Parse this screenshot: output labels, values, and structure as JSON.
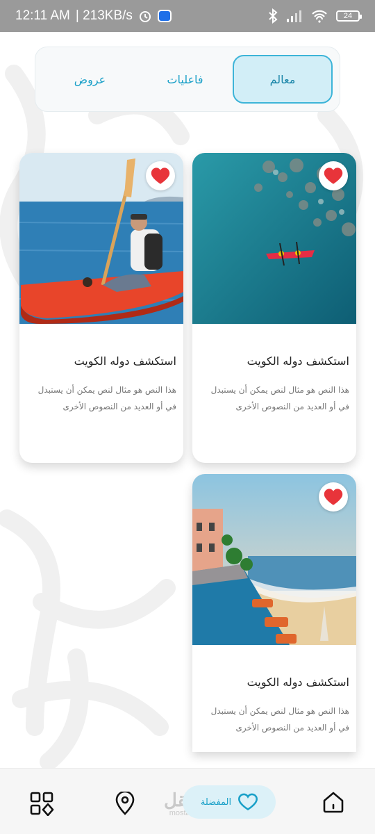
{
  "status_bar": {
    "time": "12:11 AM",
    "speed": "| 213KB/s",
    "battery": "24",
    "icons": [
      "alarm-icon",
      "message-app-icon",
      "bluetooth-icon",
      "signal-icon",
      "wifi-icon",
      "battery-icon"
    ]
  },
  "tabs": [
    {
      "label": "معالم",
      "active": true
    },
    {
      "label": "فاعليات",
      "active": false
    },
    {
      "label": "عروض",
      "active": false
    }
  ],
  "cards": [
    {
      "title": "استكشف دوله الكويت",
      "desc": "هذا النص هو مثال لنص يمكن أن يستبدل في أو العديد من النصوص الأخرى",
      "image": "aerial-kayak-sea",
      "favorited": true
    },
    {
      "title": "استكشف دوله الكويت",
      "desc": "هذا النص هو مثال لنص يمكن أن يستبدل في أو العديد من النصوص الأخرى",
      "image": "man-kayaking",
      "favorited": true
    },
    {
      "title": "استكشف دوله الكويت",
      "desc": "هذا النص هو مثال لنص يمكن أن يستبدل في أو العديد من النصوص الأخرى",
      "image": "beach-resort-pool",
      "favorited": true
    }
  ],
  "bottom_nav": {
    "favorites_label": "المفضلة",
    "items": [
      "home-icon",
      "heart-icon",
      "location-pin-icon",
      "grid-menu-icon"
    ]
  },
  "watermark": {
    "arabic": "مستقل",
    "latin": "mostaql.com"
  },
  "colors": {
    "accent": "#1aa0c8",
    "active_tab_bg": "#d2eef7",
    "heart": "#e8343a",
    "status_bar": "#9a9a9a"
  }
}
